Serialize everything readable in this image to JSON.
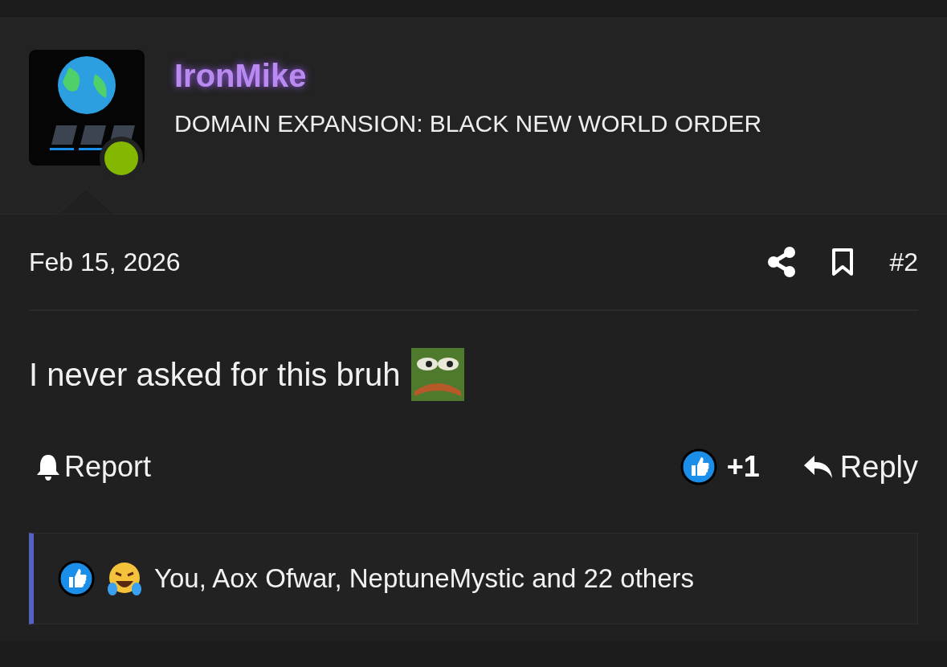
{
  "author": {
    "username": "IronMike",
    "user_title": "DOMAIN EXPANSION: BLACK NEW WORLD ORDER",
    "online": true
  },
  "post": {
    "date": "Feb 15, 2026",
    "number": "#2",
    "body": "I never asked for this bruh"
  },
  "actions": {
    "report": "Report",
    "like_count": "+1",
    "reply": "Reply"
  },
  "reactions_summary": "You, Aox Ofwar, NeptuneMystic and 22 others"
}
